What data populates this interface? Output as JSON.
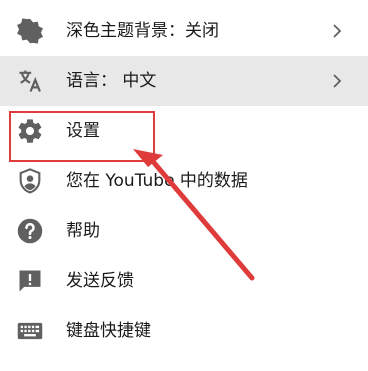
{
  "menu": {
    "items": [
      {
        "label": "深色主题背景：关闭",
        "icon": "dark-theme-icon",
        "has_chevron": true
      },
      {
        "label": "语言： 中文",
        "icon": "translate-icon",
        "has_chevron": true,
        "highlighted": true
      },
      {
        "label": "设置",
        "icon": "gear-icon",
        "has_chevron": false
      },
      {
        "label": "您在 YouTube 中的数据",
        "icon": "shield-person-icon",
        "has_chevron": false
      },
      {
        "label": "帮助",
        "icon": "help-icon",
        "has_chevron": false
      },
      {
        "label": "发送反馈",
        "icon": "feedback-icon",
        "has_chevron": false
      },
      {
        "label": "键盘快捷键",
        "icon": "keyboard-icon",
        "has_chevron": false
      }
    ]
  },
  "annotation": {
    "color": "#e03b3b",
    "target": "设置"
  },
  "colors": {
    "icon": "#606060",
    "hover_bg": "#e8e8e8",
    "annotation": "#e03b3b"
  }
}
